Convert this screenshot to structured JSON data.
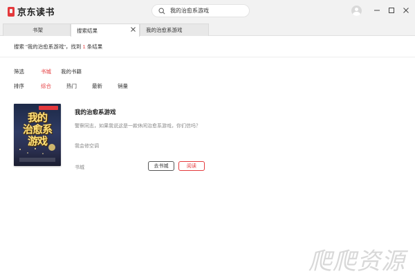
{
  "app": {
    "name": "京东读书"
  },
  "search": {
    "query": "我的治愈系游戏"
  },
  "tabs": [
    {
      "label": "书架",
      "active": false
    },
    {
      "label": "搜索结果",
      "active": true
    },
    {
      "label": "我的治愈系游戏",
      "active": false
    }
  ],
  "result": {
    "prefix": "搜索 \"我的治愈系游戏\"，找到",
    "count": "1",
    "suffix": "条结果"
  },
  "filter": {
    "label": "筛选",
    "options": [
      "书城",
      "我的书籍"
    ],
    "selected": "书城"
  },
  "sort": {
    "label": "排序",
    "options": [
      "综合",
      "热门",
      "最新",
      "销量"
    ],
    "selected": "综合"
  },
  "book": {
    "title": "我的治愈系游戏",
    "description": "警察同志，如果我说这是一款休闲治愈系游戏，你们信吗？",
    "author": "我会修空调",
    "source": "书城",
    "cover_title": "我的治愈系游戏",
    "cover_art_lines": [
      "我的",
      "治愈系",
      "游戏"
    ],
    "store_button": "去书城",
    "read_button": "阅读"
  },
  "colors": {
    "accent": "#e4393c",
    "titlebar": "#f2f2f2"
  },
  "icons": {
    "search": "search-icon",
    "minimize": "minimize-icon",
    "maximize": "maximize-icon",
    "close": "close-icon"
  }
}
